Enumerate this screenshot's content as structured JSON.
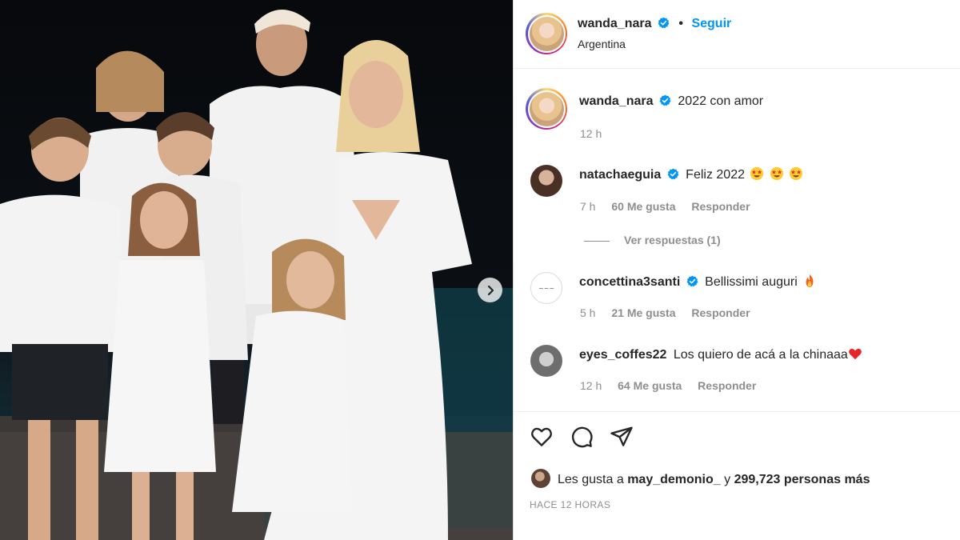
{
  "header": {
    "username": "wanda_nara",
    "follow_label": "Seguir",
    "location": "Argentina"
  },
  "caption": {
    "username": "wanda_nara",
    "text": "2022 con amor",
    "time": "12 h"
  },
  "comments": [
    {
      "username": "natachaeguia",
      "verified": true,
      "text": "Feliz 2022",
      "emoji": [
        "star-struck",
        "star-struck",
        "star-struck"
      ],
      "time": "7 h",
      "likes": "60 Me gusta",
      "reply_label": "Responder",
      "view_replies": "Ver respuestas (1)"
    },
    {
      "username": "concettina3santi",
      "verified": true,
      "text": "Bellissimi auguri",
      "emoji": [
        "fire"
      ],
      "time": "5 h",
      "likes": "21 Me gusta",
      "reply_label": "Responder"
    },
    {
      "username": "eyes_coffes22",
      "verified": false,
      "text": "Los quiero de acá a la chinaaa",
      "emoji": [
        "red-heart"
      ],
      "time": "12 h",
      "likes": "64 Me gusta",
      "reply_label": "Responder"
    }
  ],
  "likes": {
    "prefix": "Les gusta a",
    "user": "may_demonio_",
    "connector": "y",
    "count": "299,723 personas más"
  },
  "timestamp": "HACE 12 HORAS",
  "colors": {
    "link": "#0095f6",
    "verified": "#0095f6",
    "muted": "#8e8e8e",
    "text": "#262626"
  },
  "icons": [
    "verified-badge-icon",
    "heart-icon",
    "comment-icon",
    "share-icon",
    "chevron-right-icon"
  ]
}
